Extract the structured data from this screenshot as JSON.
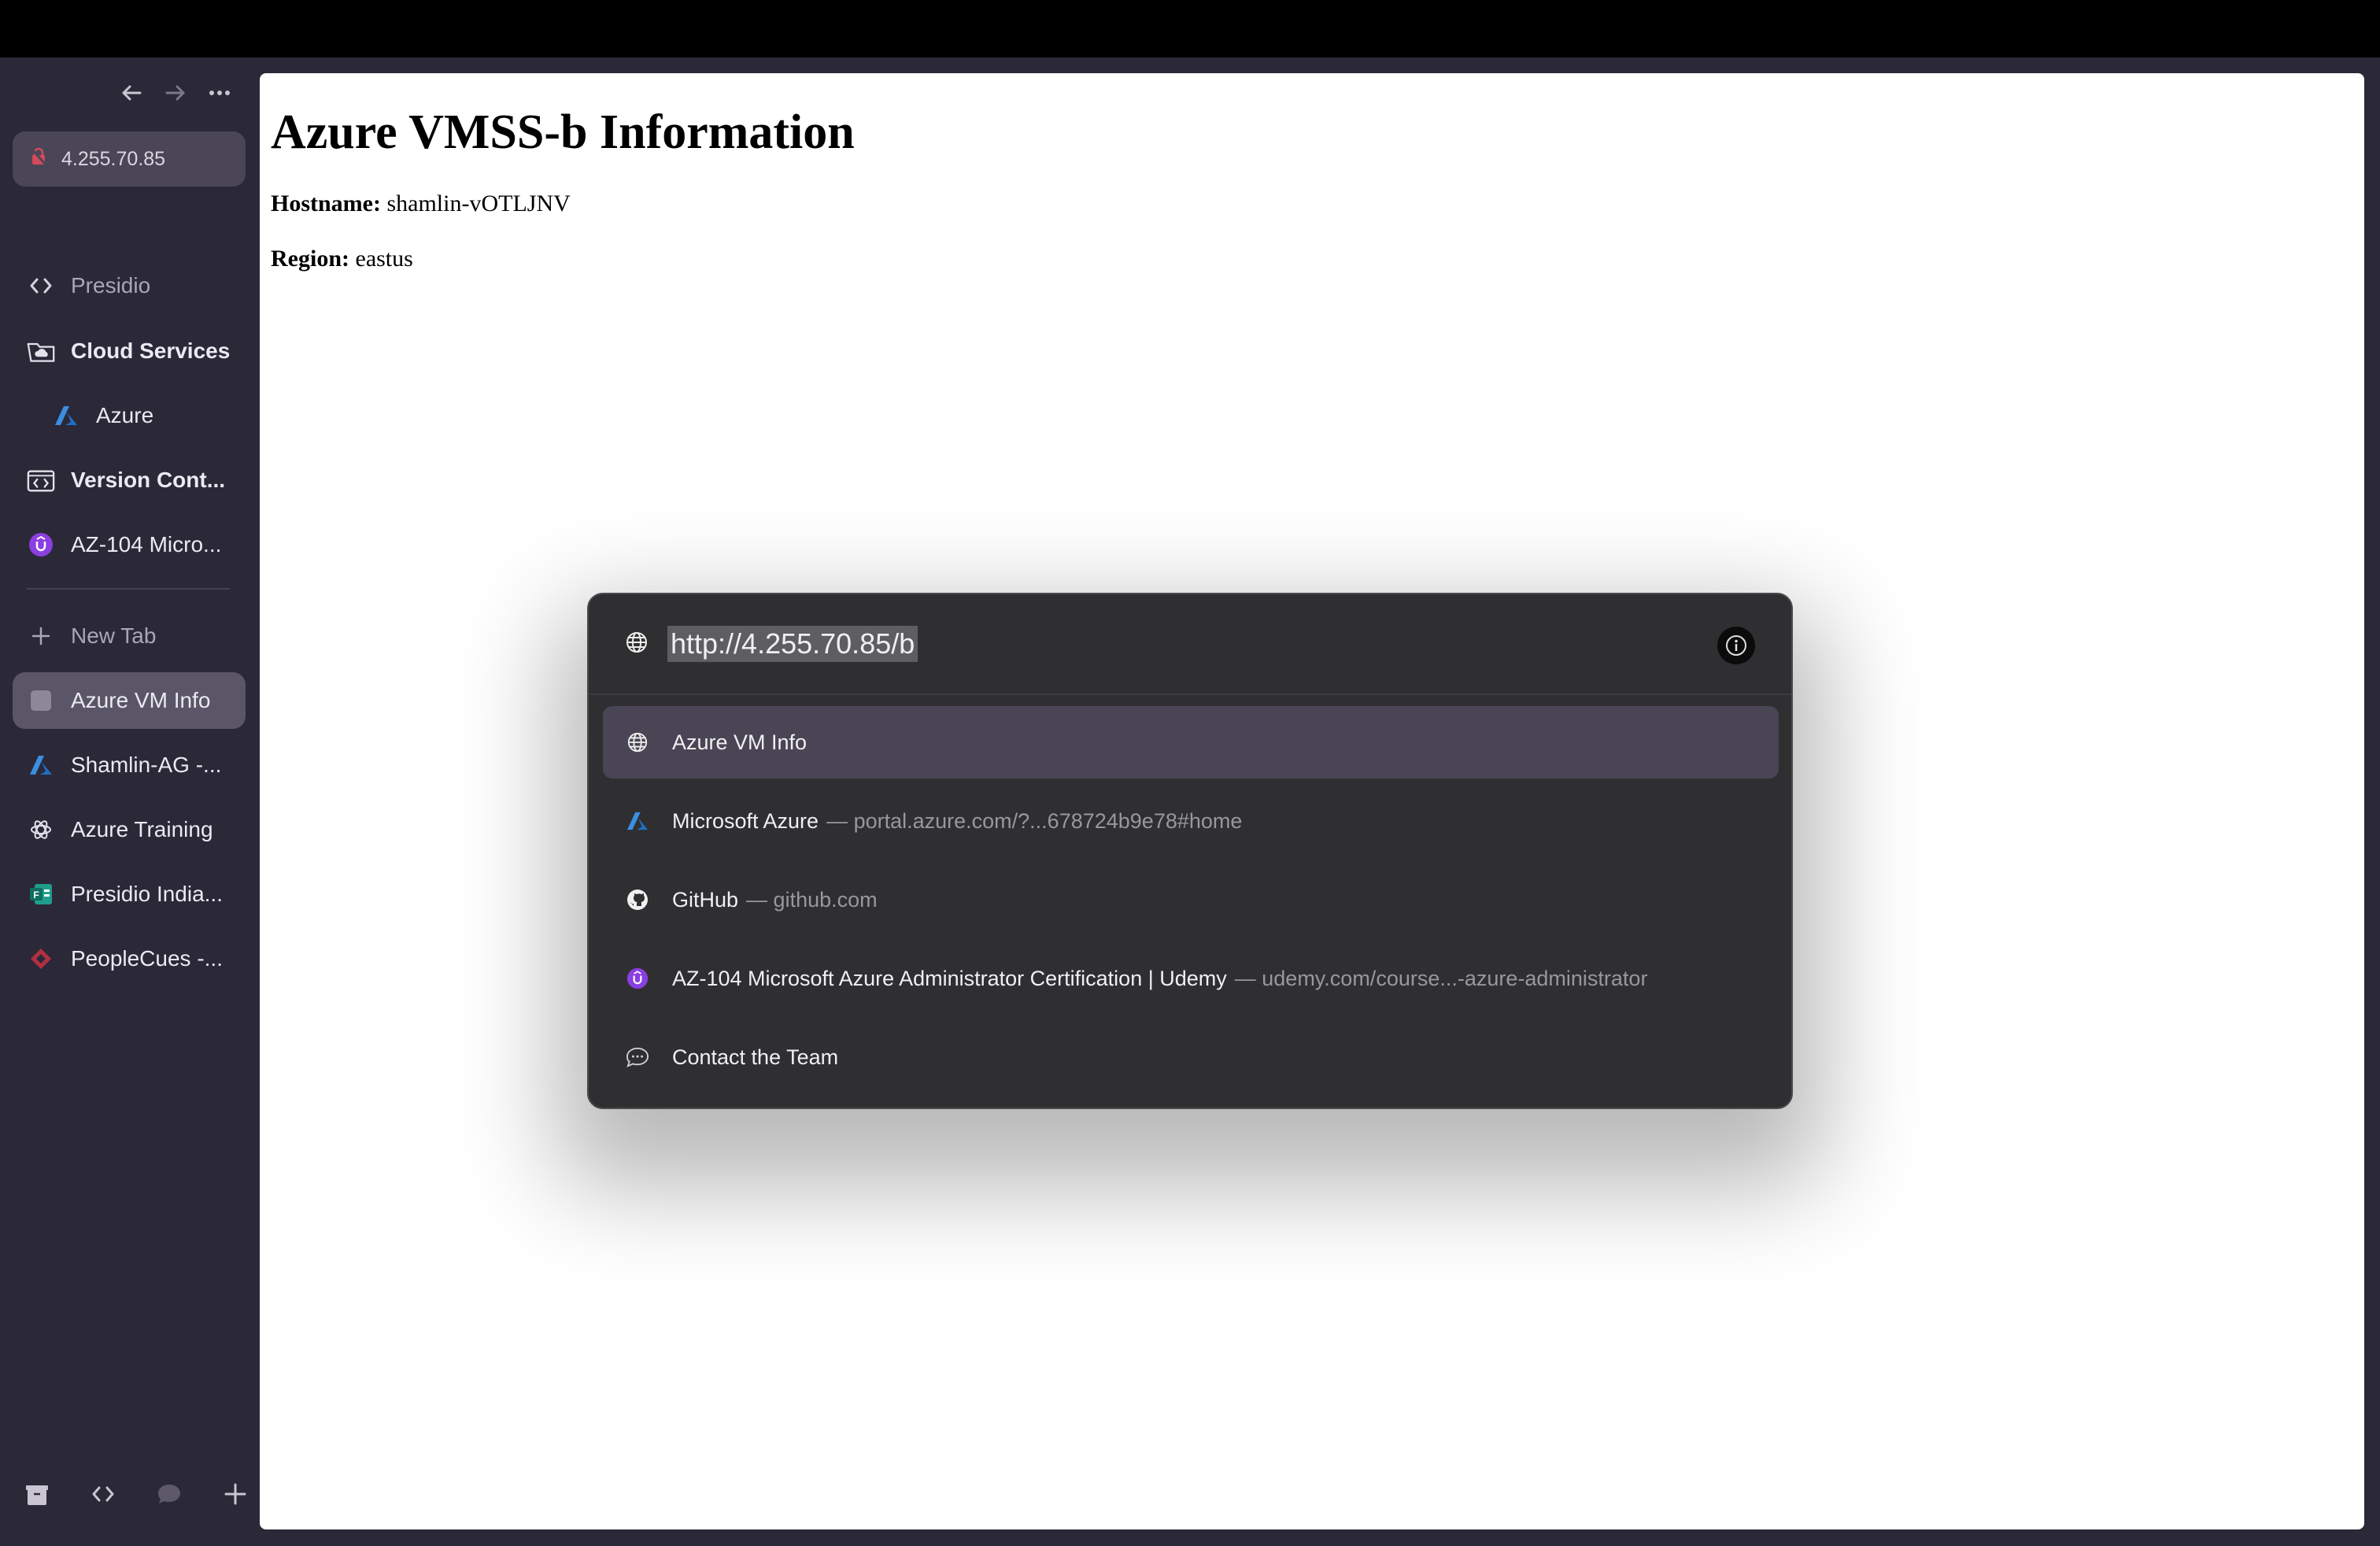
{
  "sidebar": {
    "url_pill": "4.255.70.85",
    "pinned": [
      {
        "label": "Presidio",
        "icon": "code-brackets-icon"
      },
      {
        "label": "Cloud Services",
        "icon": "folder-cloud-icon"
      },
      {
        "label": "Azure",
        "icon": "azure-logo-icon"
      },
      {
        "label": "Version Cont...",
        "icon": "folder-code-icon"
      },
      {
        "label": "AZ-104 Micro...",
        "icon": "udemy-logo-icon"
      }
    ],
    "new_tab": "New Tab",
    "tabs": [
      {
        "label": "Azure VM Info",
        "icon": "page-icon"
      },
      {
        "label": "Shamlin-AG -...",
        "icon": "azure-logo-icon"
      },
      {
        "label": "Azure Training",
        "icon": "openai-logo-icon"
      },
      {
        "label": "Presidio India...",
        "icon": "forms-logo-icon"
      },
      {
        "label": "PeopleCues -...",
        "icon": "peoplecues-logo-icon"
      }
    ]
  },
  "page": {
    "title": "Azure VMSS-b Information",
    "hostname_label": "Hostname:",
    "hostname_value": "shamlin-vOTLJNV",
    "region_label": "Region:",
    "region_value": "eastus"
  },
  "palette": {
    "url": "http://4.255.70.85/b",
    "results": [
      {
        "title": "Azure VM Info",
        "sub": "",
        "icon": "globe-icon"
      },
      {
        "title": "Microsoft Azure",
        "sub": "— portal.azure.com/?...678724b9e78#home",
        "icon": "azure-logo-icon"
      },
      {
        "title": "GitHub",
        "sub": "— github.com",
        "icon": "github-logo-icon"
      },
      {
        "title": "AZ-104 Microsoft Azure Administrator Certification | Udemy",
        "sub": "— udemy.com/course...-azure-administrator",
        "icon": "udemy-logo-icon"
      },
      {
        "title": "Contact the Team",
        "sub": "",
        "icon": "chat-bubble-icon"
      }
    ]
  }
}
